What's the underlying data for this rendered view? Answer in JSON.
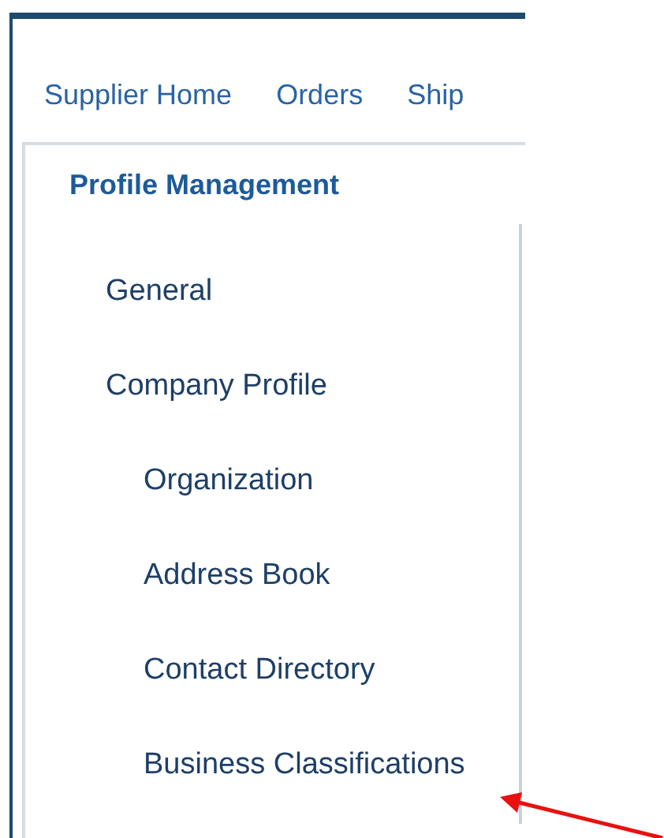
{
  "nav": {
    "items": [
      {
        "label": "Supplier Home"
      },
      {
        "label": "Orders"
      },
      {
        "label": "Ship"
      }
    ]
  },
  "panel": {
    "title": "Profile Management",
    "items": [
      {
        "label": "General"
      },
      {
        "label": "Company Profile",
        "children": [
          {
            "label": "Organization"
          },
          {
            "label": "Address Book"
          },
          {
            "label": "Contact Directory"
          },
          {
            "label": "Business Classifications"
          }
        ]
      }
    ]
  }
}
